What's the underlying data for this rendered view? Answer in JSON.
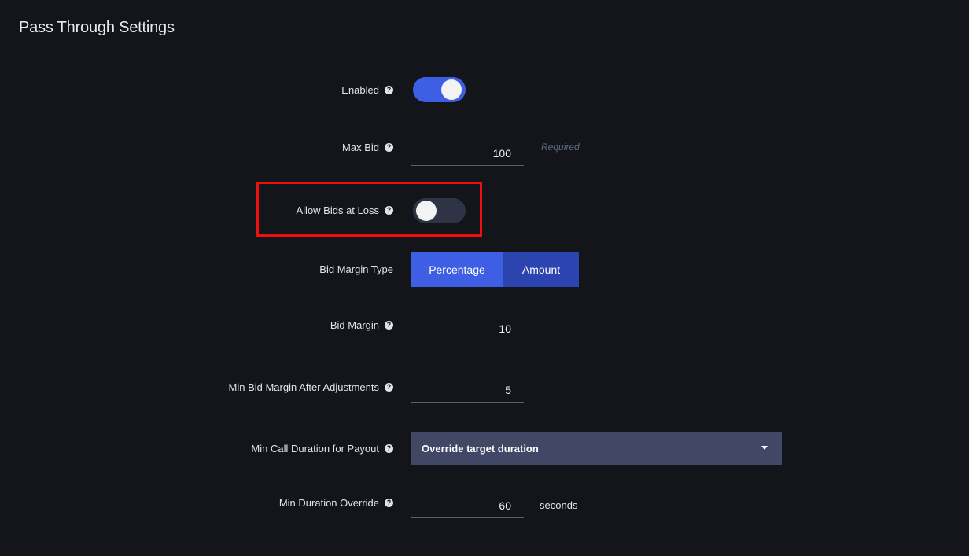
{
  "section": {
    "title": "Pass Through Settings"
  },
  "fields": {
    "enabled": {
      "label": "Enabled",
      "value": "on"
    },
    "max_bid": {
      "label": "Max Bid",
      "value": "100",
      "hint": "Required"
    },
    "allow_bids_at_loss": {
      "label": "Allow Bids at Loss",
      "value": "off"
    },
    "bid_margin_type": {
      "label": "Bid Margin Type",
      "options": [
        "Percentage",
        "Amount"
      ],
      "selected": "Percentage"
    },
    "bid_margin": {
      "label": "Bid Margin",
      "value": "10"
    },
    "min_bid_margin_after_adjustments": {
      "label": "Min Bid Margin After Adjustments",
      "value": "5"
    },
    "min_call_duration_for_payout": {
      "label": "Min Call Duration for Payout",
      "selected": "Override target duration"
    },
    "min_duration_override": {
      "label": "Min Duration Override",
      "value": "60",
      "suffix": "seconds"
    }
  },
  "icons": {
    "help": "question-circle-icon",
    "dropdown": "caret-down-icon"
  },
  "colors": {
    "background": "#14151a",
    "accent": "#3e5fe3",
    "accent_dark": "#2b44b0",
    "toggle_off": "#2f3346",
    "select_bg": "#434766",
    "highlight": "#ee0f0f",
    "hint": "#5b6b8a"
  }
}
